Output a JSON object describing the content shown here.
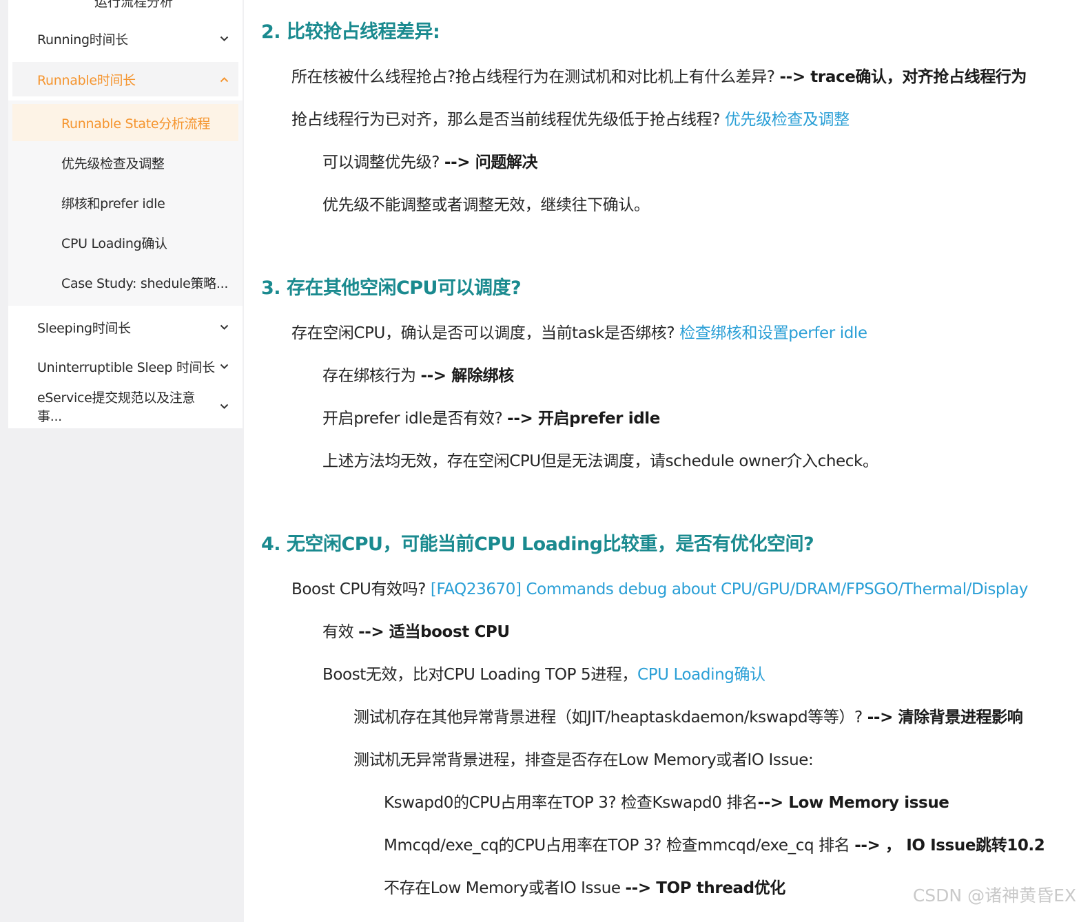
{
  "sidebar": {
    "clipped_item": "运行流程分析",
    "items": [
      {
        "label": "Running时间长",
        "expanded": false
      },
      {
        "label": "Runnable时间长",
        "expanded": true
      },
      {
        "label": "Sleeping时间长",
        "expanded": false
      },
      {
        "label": "Uninterruptible Sleep 时间长",
        "expanded": false
      },
      {
        "label": "eService提交规范以及注意事...",
        "expanded": false
      }
    ],
    "sub_items": [
      {
        "label": "Runnable State分析流程",
        "selected": true
      },
      {
        "label": "优先级检查及调整",
        "selected": false
      },
      {
        "label": "绑核和prefer idle",
        "selected": false
      },
      {
        "label": "CPU Loading确认",
        "selected": false
      },
      {
        "label": "Case Study: shedule策略...",
        "selected": false
      }
    ]
  },
  "content": {
    "s2": {
      "heading": "2. 比较抢占线程差异:",
      "p1_text": "所在核被什么线程抢占?抢占线程行为在测试机和对比机上有什么差异? ",
      "p1_bold": "--> trace确认，对齐抢占线程行为",
      "p2_text": "抢占线程行为已对齐，那么是否当前线程优先级低于抢占线程? ",
      "p2_link": "优先级检查及调整",
      "p3_text": "可以调整优先级?  ",
      "p3_bold": "--> 问题解决",
      "p4_text": "优先级不能调整或者调整无效，继续往下确认。"
    },
    "s3": {
      "heading": "3. 存在其他空闲CPU可以调度?",
      "p1_text": "存在空闲CPU，确认是否可以调度，当前task是否绑核? ",
      "p1_link": "检查绑核和设置perfer idle",
      "p2_text": "存在绑核行为 ",
      "p2_bold": "--> 解除绑核",
      "p3_text": "开启prefer idle是否有效?  ",
      "p3_bold": "--> 开启prefer idle",
      "p4_text": "上述方法均无效，存在空闲CPU但是无法调度，请schedule owner介入check。"
    },
    "s4": {
      "heading": "4. 无空闲CPU，可能当前CPU Loading比较重，是否有优化空间?",
      "p1_text": "Boost CPU有效吗? ",
      "p1_link": "[FAQ23670] Commands debug about CPU/GPU/DRAM/FPSGO/Thermal/Display",
      "p2_text": "有效 ",
      "p2_bold": "--> 适当boost CPU",
      "p3_text": "Boost无效，比对CPU Loading TOP 5进程，",
      "p3_link": "CPU Loading确认",
      "p4_text": "测试机存在其他异常背景进程（如JIT/heaptaskdaemon/kswapd等等）? ",
      "p4_bold": "--> 清除背景进程影响",
      "p5_text": "测试机无异常背景进程，排查是否存在Low Memory或者IO Issue:",
      "p6_text": "Kswapd0的CPU占用率在TOP 3? 检查Kswapd0 排名",
      "p6_bold": "--> Low Memory issue",
      "p7_text": "Mmcqd/exe_cq的CPU占用率在TOP 3? 检查mmcqd/exe_cq 排名 ",
      "p7_bold": "--> ， IO Issue跳转10.2",
      "p8_text": "不存在Low Memory或者IO Issue ",
      "p8_bold": "--> TOP thread优化"
    }
  },
  "watermark": "CSDN @诸神黄昏EX"
}
